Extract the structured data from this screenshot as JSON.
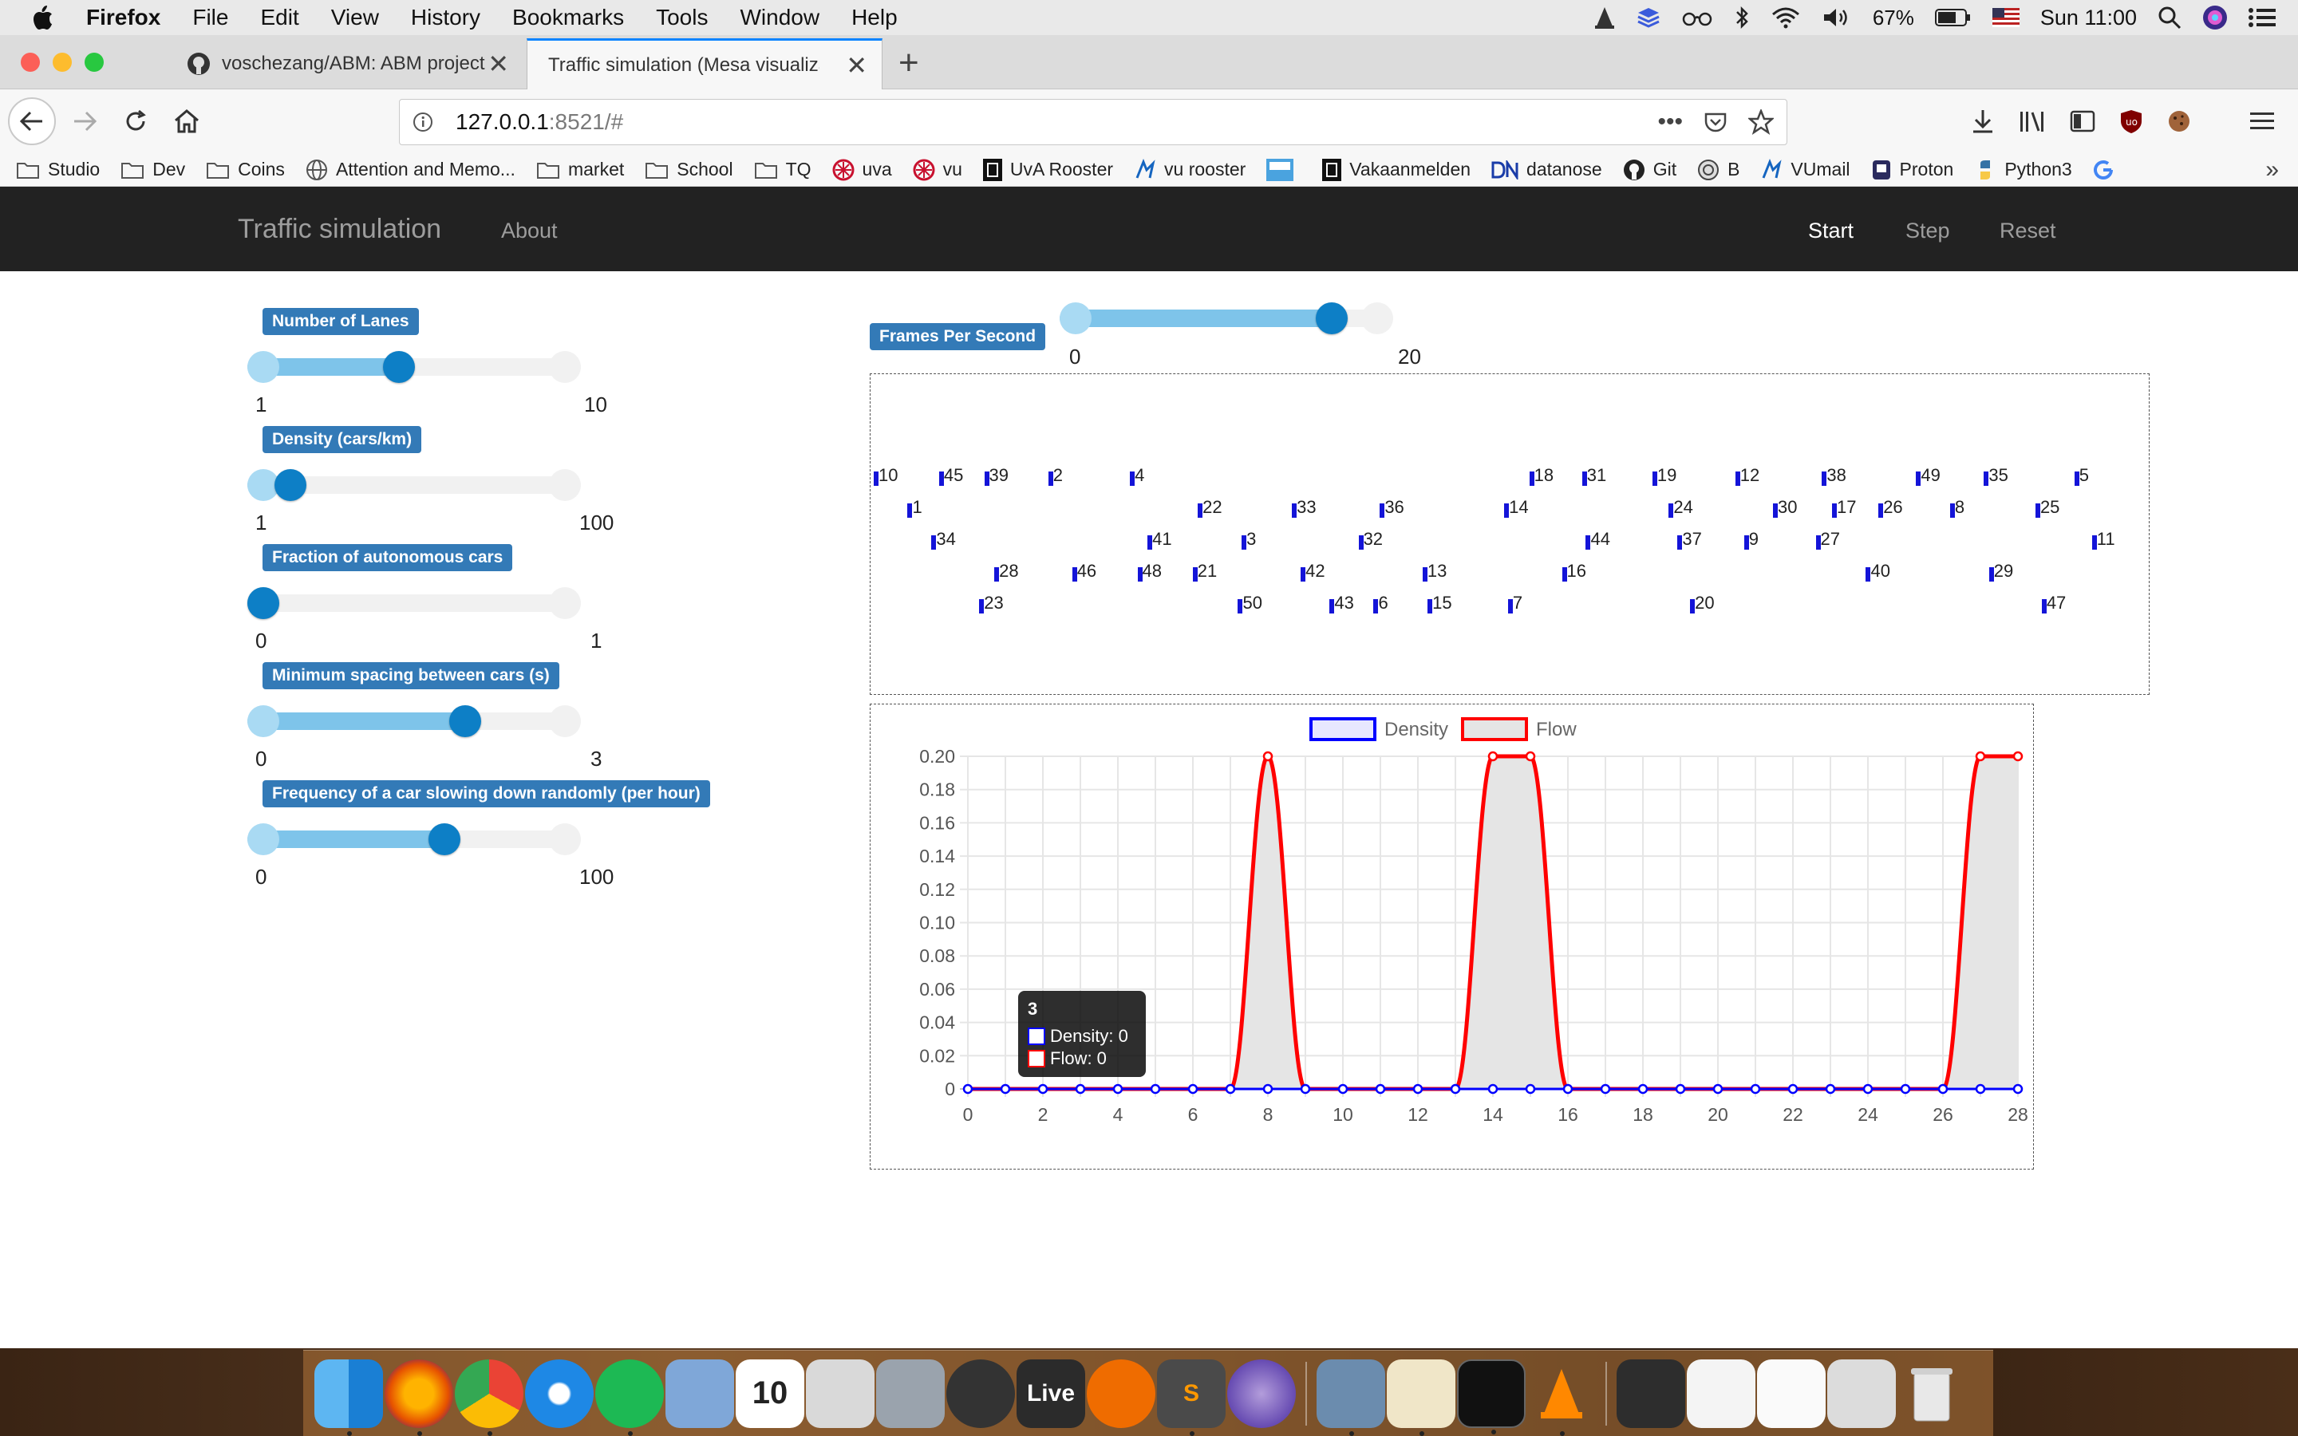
{
  "menubar": {
    "app": "Firefox",
    "items": [
      "File",
      "Edit",
      "View",
      "History",
      "Bookmarks",
      "Tools",
      "Window",
      "Help"
    ],
    "battery": "67%",
    "clock": "Sun 11:00"
  },
  "browser": {
    "tabs": [
      {
        "title": "voschezang/ABM: ABM project",
        "active": false
      },
      {
        "title": "Traffic simulation (Mesa visualizatio",
        "active": true
      }
    ],
    "url_host": "127.0.0.1",
    "url_rest": ":8521/#",
    "bookmarks": [
      "Studio",
      "Dev",
      "Coins",
      "Attention and Memo...",
      "market",
      "School",
      "TQ",
      "uva",
      "vu",
      "UvA Rooster",
      "vu rooster",
      "",
      "Vakaanmelden",
      "datanose",
      "Git",
      "B",
      "VUmail",
      "Proton",
      "Python3"
    ]
  },
  "app": {
    "brand": "Traffic simulation",
    "about": "About",
    "start": "Start",
    "step": "Step",
    "reset": "Reset"
  },
  "params": [
    {
      "label": "Number of Lanes",
      "min": "1",
      "max": "10",
      "fraction": 0.45
    },
    {
      "label": "Density (cars/km)",
      "min": "1",
      "max": "100",
      "fraction": 0.09
    },
    {
      "label": "Fraction of autonomous cars",
      "min": "0",
      "max": "1",
      "fraction": 0.0
    },
    {
      "label": "Minimum spacing between cars (s)",
      "min": "0",
      "max": "3",
      "fraction": 0.67
    },
    {
      "label": "Frequency of a car slowing down randomly (per hour)",
      "min": "0",
      "max": "100",
      "fraction": 0.6
    }
  ],
  "fps": {
    "label": "Frames Per Second",
    "min": "0",
    "max": "20",
    "fraction": 0.85
  },
  "cars": [
    {
      "id": "10",
      "pos": 0.0,
      "row": 0
    },
    {
      "id": "45",
      "pos": 0.052,
      "row": 0
    },
    {
      "id": "39",
      "pos": 0.088,
      "row": 0
    },
    {
      "id": "2",
      "pos": 0.139,
      "row": 0
    },
    {
      "id": "4",
      "pos": 0.204,
      "row": 0
    },
    {
      "id": "18",
      "pos": 0.522,
      "row": 0
    },
    {
      "id": "31",
      "pos": 0.564,
      "row": 0
    },
    {
      "id": "19",
      "pos": 0.62,
      "row": 0
    },
    {
      "id": "12",
      "pos": 0.686,
      "row": 0
    },
    {
      "id": "38",
      "pos": 0.755,
      "row": 0
    },
    {
      "id": "49",
      "pos": 0.83,
      "row": 0
    },
    {
      "id": "35",
      "pos": 0.884,
      "row": 0
    },
    {
      "id": "5",
      "pos": 0.956,
      "row": 0
    },
    {
      "id": "1",
      "pos": 0.027,
      "row": 1
    },
    {
      "id": "22",
      "pos": 0.258,
      "row": 1
    },
    {
      "id": "33",
      "pos": 0.333,
      "row": 1
    },
    {
      "id": "36",
      "pos": 0.403,
      "row": 1
    },
    {
      "id": "14",
      "pos": 0.502,
      "row": 1
    },
    {
      "id": "24",
      "pos": 0.633,
      "row": 1
    },
    {
      "id": "30",
      "pos": 0.716,
      "row": 1
    },
    {
      "id": "17",
      "pos": 0.763,
      "row": 1
    },
    {
      "id": "26",
      "pos": 0.8,
      "row": 1
    },
    {
      "id": "8",
      "pos": 0.857,
      "row": 1
    },
    {
      "id": "25",
      "pos": 0.925,
      "row": 1
    },
    {
      "id": "34",
      "pos": 0.046,
      "row": 2
    },
    {
      "id": "41",
      "pos": 0.218,
      "row": 2
    },
    {
      "id": "3",
      "pos": 0.293,
      "row": 2
    },
    {
      "id": "32",
      "pos": 0.386,
      "row": 2
    },
    {
      "id": "44",
      "pos": 0.567,
      "row": 2
    },
    {
      "id": "37",
      "pos": 0.64,
      "row": 2
    },
    {
      "id": "9",
      "pos": 0.693,
      "row": 2
    },
    {
      "id": "27",
      "pos": 0.75,
      "row": 2
    },
    {
      "id": "11",
      "pos": 0.97,
      "row": 2
    },
    {
      "id": "28",
      "pos": 0.096,
      "row": 3
    },
    {
      "id": "46",
      "pos": 0.158,
      "row": 3
    },
    {
      "id": "48",
      "pos": 0.21,
      "row": 3
    },
    {
      "id": "21",
      "pos": 0.254,
      "row": 3
    },
    {
      "id": "42",
      "pos": 0.34,
      "row": 3
    },
    {
      "id": "13",
      "pos": 0.437,
      "row": 3
    },
    {
      "id": "16",
      "pos": 0.548,
      "row": 3
    },
    {
      "id": "40",
      "pos": 0.79,
      "row": 3
    },
    {
      "id": "29",
      "pos": 0.888,
      "row": 3
    },
    {
      "id": "23",
      "pos": 0.084,
      "row": 4
    },
    {
      "id": "50",
      "pos": 0.29,
      "row": 4
    },
    {
      "id": "43",
      "pos": 0.363,
      "row": 4
    },
    {
      "id": "6",
      "pos": 0.398,
      "row": 4
    },
    {
      "id": "15",
      "pos": 0.441,
      "row": 4
    },
    {
      "id": "7",
      "pos": 0.505,
      "row": 4
    },
    {
      "id": "20",
      "pos": 0.65,
      "row": 4
    },
    {
      "id": "47",
      "pos": 0.93,
      "row": 4
    }
  ],
  "chart_data": {
    "type": "line",
    "title": "",
    "xlabel": "",
    "ylabel": "",
    "x": [
      0,
      1,
      2,
      3,
      4,
      5,
      6,
      7,
      8,
      9,
      10,
      11,
      12,
      13,
      14,
      15,
      16,
      17,
      18,
      19,
      20,
      21,
      22,
      23,
      24,
      25,
      26,
      27,
      28
    ],
    "x_ticks": [
      "0",
      "2",
      "4",
      "6",
      "8",
      "10",
      "12",
      "14",
      "16",
      "18",
      "20",
      "22",
      "24",
      "26",
      "28"
    ],
    "y_ticks": [
      "0",
      "0.02",
      "0.04",
      "0.06",
      "0.08",
      "0.10",
      "0.12",
      "0.14",
      "0.16",
      "0.18",
      "0.20"
    ],
    "xlim": [
      0,
      28
    ],
    "ylim": [
      0,
      0.2
    ],
    "grid": true,
    "legend_position": "top",
    "series": [
      {
        "name": "Density",
        "color": "#0000ff",
        "values": [
          0,
          0,
          0,
          0,
          0,
          0,
          0,
          0,
          0,
          0,
          0,
          0,
          0,
          0,
          0,
          0,
          0,
          0,
          0,
          0,
          0,
          0,
          0,
          0,
          0,
          0,
          0,
          0,
          0
        ]
      },
      {
        "name": "Flow",
        "color": "#ff0000",
        "fill": "#e5e5e5",
        "values": [
          0,
          0,
          0,
          0,
          0,
          0,
          0,
          0,
          0.2,
          0,
          0,
          0,
          0,
          0,
          0.2,
          0.2,
          0,
          0,
          0,
          0,
          0,
          0,
          0,
          0,
          0,
          0,
          0,
          0.2,
          0.2
        ]
      }
    ]
  },
  "tooltip": {
    "title": "3",
    "density": "Density: 0",
    "flow": "Flow: 0"
  },
  "dock": {
    "live_label": "Live"
  }
}
